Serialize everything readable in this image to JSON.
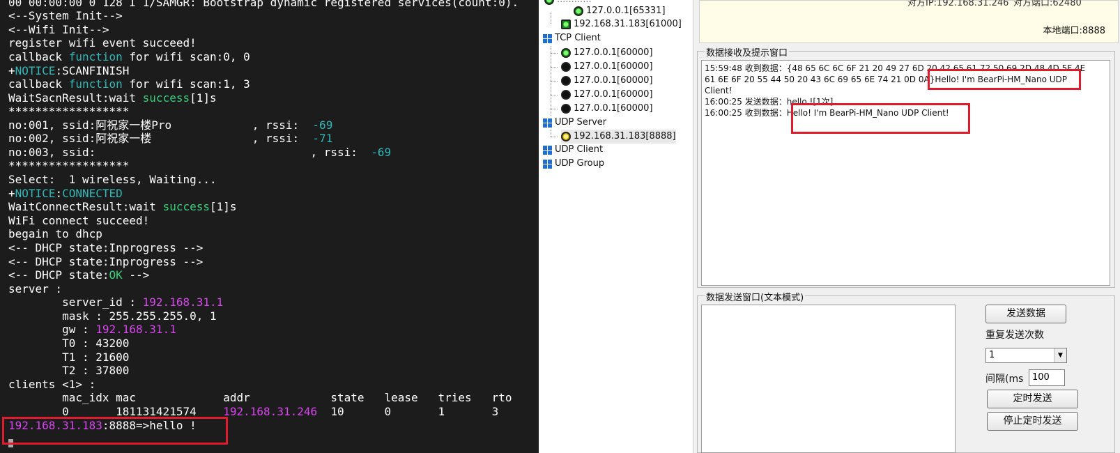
{
  "terminal": {
    "lines": [
      "00 00:00:00 0 128 I 1/SAMGR: Bootstrap dynamic registered services(count:0).",
      "<--System Init-->",
      "<--Wifi Init-->",
      "register wifi event succeed!",
      "callback ",
      "function",
      " for wifi scan:0, 0",
      "+",
      "NOTICE",
      ":SCANFINISH",
      "callback ",
      "function",
      " for wifi scan:1, 3",
      "WaitSacnResult:wait ",
      "success",
      "[1]s",
      "******************",
      "no:001, ssid:阿祝家一楼Pro            , rssi:  ",
      "-69",
      "no:002, ssid:阿祝家一楼               , rssi:  ",
      "-71",
      "no:003, ssid:                                , rssi:  ",
      "-69",
      "******************",
      "Select:  1 wireless, Waiting...",
      "+",
      "NOTICE",
      ":",
      "CONNECTED",
      "WaitConnectResult:wait ",
      "success",
      "[1]s",
      "WiFi connect succeed!",
      "begain to dhcp",
      "<-- DHCP state:Inprogress -->",
      "<-- DHCP state:Inprogress -->",
      "<-- DHCP state:",
      "OK",
      " -->",
      "server :",
      "        server_id : ",
      "192.168.31.1",
      "        mask : 255.255.255.0, 1",
      "        gw : ",
      "192.168.31.1",
      "        T0 : 43200",
      "        T1 : 21600",
      "        T2 : 37800",
      "clients <1> :",
      "        mac_idx mac             addr            state   lease   tries   rto",
      "        0       181131421574    ",
      "192.168.31.246",
      "  10      0       1       3",
      "192.168.31.183",
      ":8888=>hello !"
    ]
  },
  "tree": {
    "items": [
      {
        "label": "127.0.0.1[65331]",
        "kind": "led-green"
      },
      {
        "label": "192.168.31.183[61000]",
        "kind": "monitor"
      },
      {
        "label": "TCP Client",
        "kind": "group"
      },
      {
        "label": "127.0.0.1[60000]",
        "kind": "led-green"
      },
      {
        "label": "127.0.0.1[60000]",
        "kind": "led-dark"
      },
      {
        "label": "127.0.0.1[60000]",
        "kind": "led-dark"
      },
      {
        "label": "127.0.0.1[60000]",
        "kind": "led-dark"
      },
      {
        "label": "127.0.0.1[60000]",
        "kind": "led-dark"
      },
      {
        "label": "UDP Server",
        "kind": "group"
      },
      {
        "label": "192.168.31.183[8888]",
        "kind": "led-yellow"
      },
      {
        "label": "UDP Client",
        "kind": "group"
      },
      {
        "label": "UDP Group",
        "kind": "group"
      }
    ]
  },
  "panel": {
    "top_partial_left": "对方IP:192.168.31.246",
    "top_partial_right": "对方端口:62480",
    "local_port": "本地端口:8888",
    "recv_title": "数据接收及提示窗口",
    "recv_lines": [
      "15:59:48 收到数据：{48 65 6C 6C 6F 21 20 49 27 6D 20 42 65 61 72 50 69 2D 48 4D 5F 4E",
      "61 6E 6F 20 55 44 50 20 43 6C 69 65 6E 74 21 0D 0A}Hello! I'm BearPi-HM_Nano UDP",
      "Client!",
      "",
      "16:00:25 发送数据：hello ![1次]",
      "16:00:25 收到数据：Hello! I'm BearPi-HM_Nano UDP Client!"
    ],
    "send_title": "数据发送窗口(文本模式)",
    "send_button": "发送数据",
    "repeat_label": "重复发送次数",
    "repeat_value": "1",
    "interval_label": "间隔(ms",
    "interval_value": "100",
    "timer_send_button": "定时发送",
    "stop_timer_button": "停止定时发送"
  },
  "colors": {
    "terminal_bg": "#1c1c1c",
    "keyword_cyan": "#2fb9b9",
    "success_green": "#35d07b",
    "ip_magenta": "#d946ef",
    "highlight_red": "#e01b2b"
  }
}
